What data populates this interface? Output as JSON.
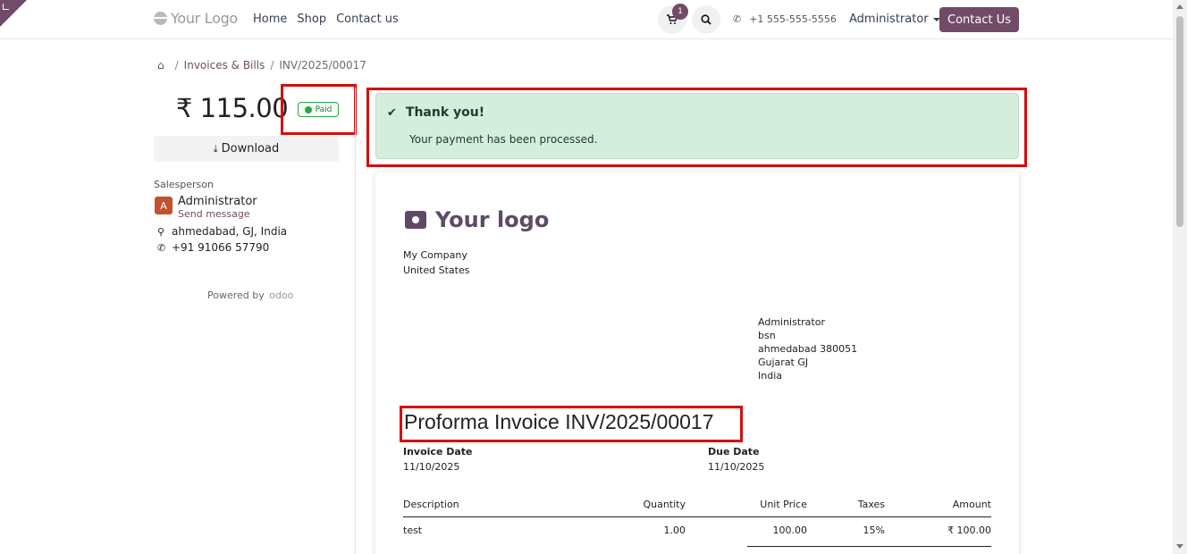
{
  "navbar": {
    "brand": "Your Logo",
    "links": [
      "Home",
      "Shop",
      "Contact us"
    ],
    "cart_count": "1",
    "phone": "+1 555-555-5556",
    "user": "Administrator",
    "contact_button": "Contact Us"
  },
  "breadcrumb": {
    "items": [
      "Invoices & Bills",
      "INV/2025/00017"
    ]
  },
  "summary": {
    "amount": "₹ 115.00",
    "status": "Paid",
    "download_label": "Download",
    "salesperson_label": "Salesperson",
    "avatar_letter": "A",
    "salesperson_name": "Administrator",
    "send_message": "Send message",
    "address": "ahmedabad, GJ, India",
    "phone": "+91 91066 57790",
    "powered_by": "Powered by",
    "powered_brand": "odoo"
  },
  "alert": {
    "title": "Thank you!",
    "message": "Your payment has been processed."
  },
  "invoice": {
    "logo_text": "Your logo",
    "company_lines": [
      "My Company",
      "United States"
    ],
    "customer_lines": [
      "Administrator",
      "bsn",
      "ahmedabad 380051",
      "Gujarat GJ",
      "India"
    ],
    "title": "Proforma Invoice INV/2025/00017",
    "invoice_date_label": "Invoice Date",
    "invoice_date": "11/10/2025",
    "due_date_label": "Due Date",
    "due_date": "11/10/2025",
    "columns": [
      "Description",
      "Quantity",
      "Unit Price",
      "Taxes",
      "Amount"
    ],
    "lines": [
      {
        "description": "test",
        "quantity": "1.00",
        "unit_price": "100.00",
        "taxes": "15%",
        "amount": "₹ 100.00"
      }
    ]
  },
  "colors": {
    "brand": "#714b67",
    "highlight": "#d90b0b",
    "success_bg": "#d4eddc"
  }
}
